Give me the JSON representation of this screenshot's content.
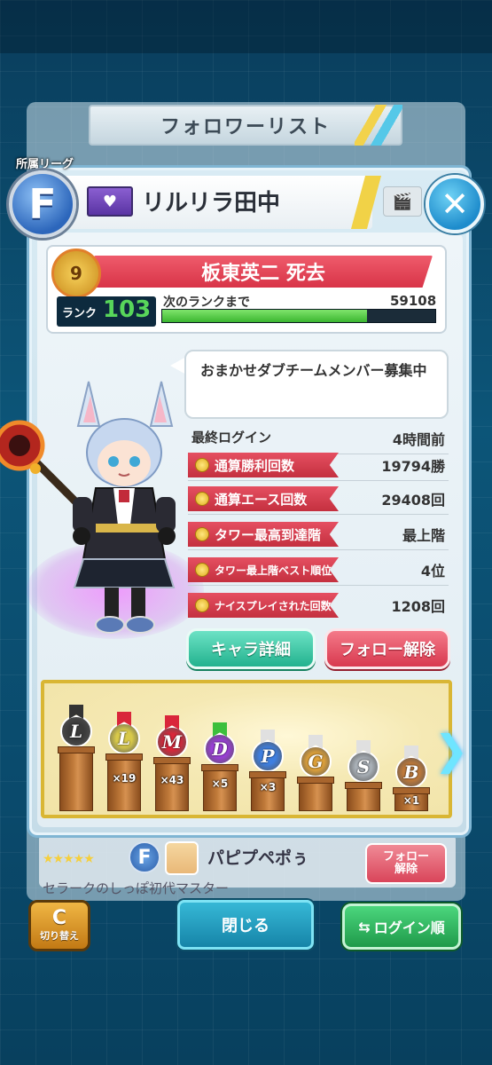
{
  "list": {
    "title": "フォロワーリスト",
    "behind_row": {
      "league": "F",
      "name": "パピプペポぅ",
      "sub": "セラークのしっぽ初代マスター",
      "button": "フォロー\n解除",
      "stars": "★★★★★"
    }
  },
  "modal": {
    "league_label": "所属リーグ",
    "league": "F",
    "player_name": "リルリラ田中",
    "close_symbol": "✕",
    "title_badge": "9",
    "title": "板東英二 死去",
    "rank_label": "ランク",
    "rank": "103",
    "next_rank_label": "次のランクまで",
    "next_rank_value": "59108",
    "exp_progress": 0.75,
    "comment": "おまかせダブチームメンバー募集中",
    "stats": [
      {
        "label": "最終ログイン",
        "value": "4時間前",
        "style": "plain"
      },
      {
        "label": "通算勝利回数",
        "value": "19794勝",
        "style": "red"
      },
      {
        "label": "通算エース回数",
        "value": "29408回",
        "style": "red"
      },
      {
        "label": "タワー最高到達階",
        "value": "最上階",
        "style": "red"
      },
      {
        "label": "タワー最上階ベスト順位",
        "value": "4位",
        "style": "red"
      },
      {
        "label": "ナイスプレイされた回数",
        "value": "1208回",
        "style": "red"
      }
    ],
    "chara_button": "キャラ詳細",
    "unfollow_button": "フォロー解除",
    "medals": [
      {
        "letter": "L",
        "count": ""
      },
      {
        "letter": "L",
        "count": "×19"
      },
      {
        "letter": "M",
        "count": "×43"
      },
      {
        "letter": "D",
        "count": "×5"
      },
      {
        "letter": "P",
        "count": "×3"
      },
      {
        "letter": "G",
        "count": ""
      },
      {
        "letter": "S",
        "count": ""
      },
      {
        "letter": "B",
        "count": "×1"
      }
    ],
    "next_symbol": "❯"
  },
  "bottom": {
    "switch_icon": "C",
    "switch_label": "切り替え",
    "close_label": "閉じる",
    "login_order_label": "ログイン順"
  },
  "colors": {
    "accent_red": "#d83448",
    "accent_green": "#23b28e",
    "exp_green": "#3bb630"
  }
}
